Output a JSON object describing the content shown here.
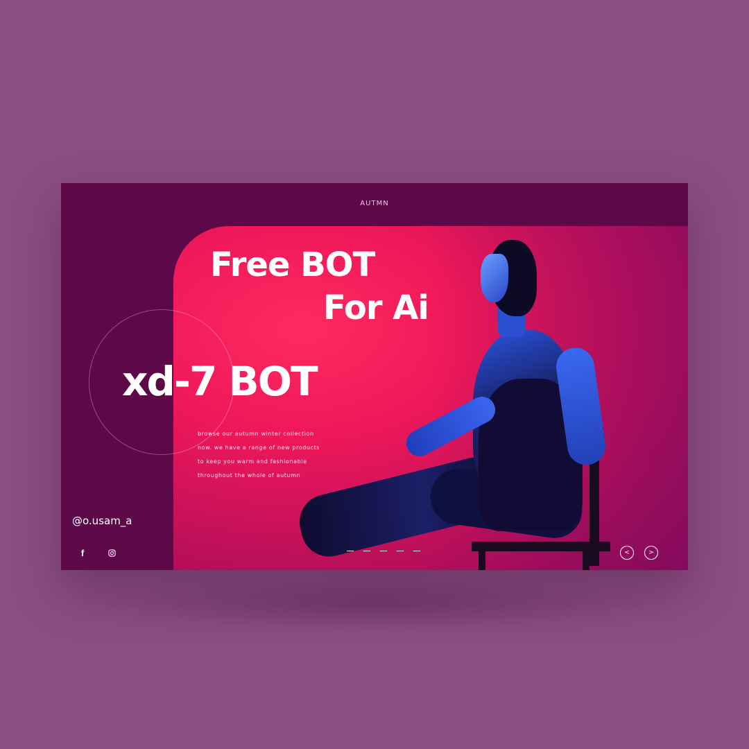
{
  "header": {
    "title": "AUTMN"
  },
  "hero": {
    "headline_line1": "Free BOT",
    "headline_line2": "For Ai",
    "brand": "xd-7 BOT",
    "description": [
      "browse our autumn winter collection",
      "now. we have a range of new products",
      "to keep you warm and fashionable",
      "throughout the whole of autumn"
    ]
  },
  "footer": {
    "handle": "@o.usam_a",
    "social": [
      {
        "icon": "facebook-icon",
        "glyph": "f"
      },
      {
        "icon": "instagram-icon",
        "glyph": "◎"
      }
    ],
    "pagination_count": 5,
    "prev_label": "<",
    "next_label": ">"
  },
  "colors": {
    "page_background": "#8b4d82",
    "card_background": "#5d0848",
    "hero_accent": "#f0185a",
    "text": "#ffffff"
  }
}
